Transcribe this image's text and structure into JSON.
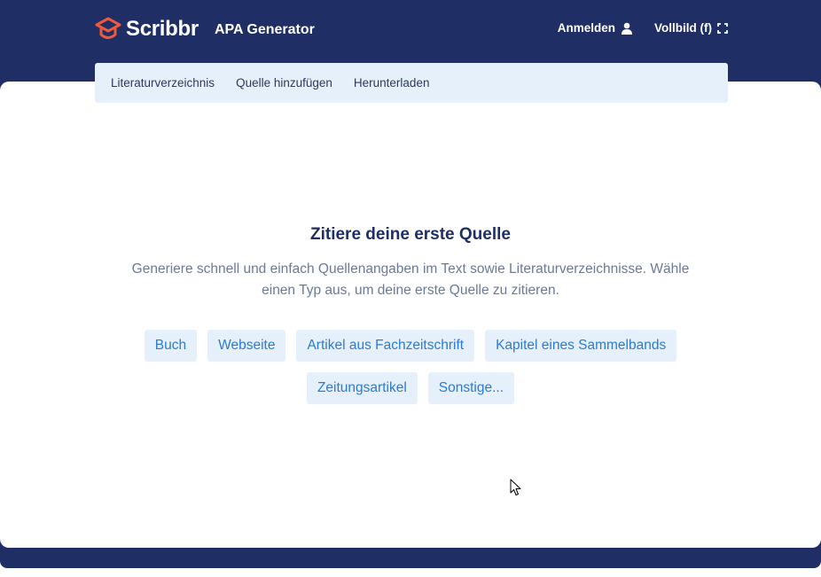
{
  "header": {
    "brand_name": "Scribbr",
    "product_name": "APA Generator",
    "login_label": "Anmelden",
    "fullscreen_label": "Vollbild (f)"
  },
  "tabs": [
    {
      "label": "Literaturverzeichnis"
    },
    {
      "label": "Quelle hinzufügen"
    },
    {
      "label": "Herunterladen"
    }
  ],
  "empty_state": {
    "title": "Zitiere deine erste Quelle",
    "description": "Generiere schnell und einfach Quellenangaben im Text sowie Literaturverzeichnisse. Wähle einen Typ aus, um deine erste Quelle zu zitieren."
  },
  "source_types": [
    {
      "label": "Buch"
    },
    {
      "label": "Webseite"
    },
    {
      "label": "Artikel aus Fachzeitschrift"
    },
    {
      "label": "Kapitel eines Sammelbands"
    },
    {
      "label": "Zeitungsartikel"
    },
    {
      "label": "Sonstige..."
    }
  ],
  "colors": {
    "header_bg": "#1f2f66",
    "brand_orange": "#ef5a3c",
    "accent_blue": "#2b7bd4",
    "chip_bg": "#e6f0fb"
  },
  "icons": {
    "logo": "scribbr-logo-icon",
    "login": "user-icon",
    "fullscreen": "fullscreen-icon"
  }
}
